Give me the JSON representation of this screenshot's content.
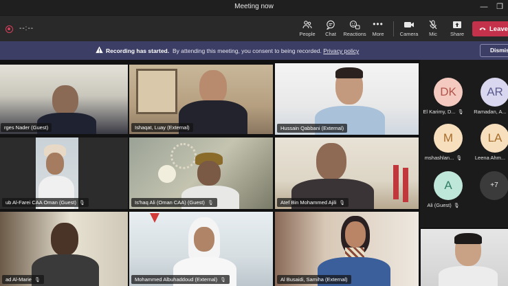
{
  "window": {
    "title": "Meeting now",
    "minimize_glyph": "—",
    "restore_glyph": "❐"
  },
  "toolbar": {
    "timer": "--:--",
    "buttons": [
      {
        "key": "people",
        "label": "People",
        "icon": "people-icon"
      },
      {
        "key": "chat",
        "label": "Chat",
        "icon": "chat-icon"
      },
      {
        "key": "reactions",
        "label": "Reactions",
        "icon": "reactions-icon"
      },
      {
        "key": "more",
        "label": "More",
        "icon": "more-icon"
      },
      {
        "key": "camera",
        "label": "Camera",
        "icon": "camera-icon"
      },
      {
        "key": "mic",
        "label": "Mic",
        "icon": "mic-off-icon"
      },
      {
        "key": "share",
        "label": "Share",
        "icon": "share-icon"
      }
    ],
    "leave_label": "Leave",
    "leave_color": "#c4314b"
  },
  "banner": {
    "heading": "Recording has started.",
    "message": "By attending this meeting, you consent to being recorded.",
    "link": "Privacy policy",
    "dismiss_label": "Dismiss",
    "background": "#3d3e66"
  },
  "tiles": [
    {
      "name": "rges Nader (Guest)",
      "muted": false,
      "active": true
    },
    {
      "name": "Ishaqat, Luay (External)",
      "muted": false,
      "active": true
    },
    {
      "name": "Hussain Qabbani (External)",
      "muted": false,
      "active": false
    },
    {
      "name": "ub Al-Farei CAA Oman (Guest)",
      "muted": true,
      "active": false
    },
    {
      "name": "Is'haq Ali (Oman CAA) (Guest)",
      "muted": true,
      "active": false
    },
    {
      "name": "Atef Bin Mohammed Ajili",
      "muted": true,
      "active": false
    },
    {
      "name": "ad Al-Marie",
      "muted": true,
      "active": false
    },
    {
      "name": "Mohammed Albuhaddoud (External)",
      "muted": true,
      "active": false
    },
    {
      "name": "Al Busaidi, Samiha (External)",
      "muted": false,
      "active": false
    }
  ],
  "participants": [
    {
      "initials": "DK",
      "name": "El Karimy, D...",
      "muted": true,
      "color": "#f3c9c0",
      "text_color": "#b0534a"
    },
    {
      "initials": "AR",
      "name": "Ramadan, A...",
      "muted": false,
      "color": "#d9d7f0",
      "text_color": "#5b5a8c"
    },
    {
      "initials": "M",
      "name": "mshashlan...",
      "muted": true,
      "color": "#f7dfbe",
      "text_color": "#a56c2a"
    },
    {
      "initials": "LA",
      "name": "Leena Ahm...",
      "muted": false,
      "color": "#f7dfbe",
      "text_color": "#a56c2a"
    },
    {
      "initials": "A",
      "name": "Ali (Guest)",
      "muted": true,
      "color": "#bfe7d9",
      "text_color": "#2f7c64"
    }
  ],
  "overflow_count": "+7"
}
